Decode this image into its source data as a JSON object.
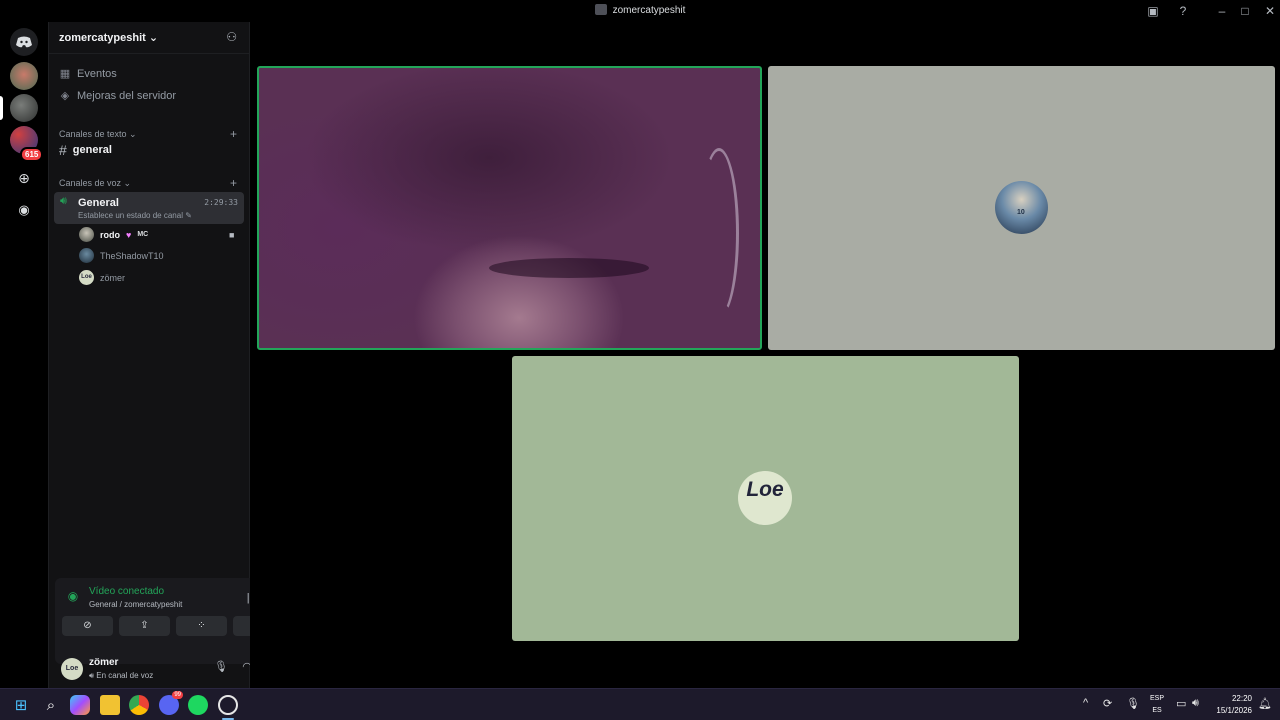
{
  "window": {
    "title": "zomercatypeshit"
  },
  "server": {
    "name": "zomercatypeshit",
    "name_suffix": "⌄"
  },
  "nav": [
    {
      "label": "Eventos"
    },
    {
      "label": "Mejoras del servidor"
    }
  ],
  "categories": {
    "text": "Canales de texto",
    "voice": "Canales de voz"
  },
  "text_channel": {
    "name": "general"
  },
  "voice_channel": {
    "name": "General",
    "status": "Establece un estado de canal",
    "duration": "2:29:33",
    "members": [
      {
        "name": "rodo",
        "tag": "MC",
        "streaming": true
      },
      {
        "name": "TheShadowT10"
      },
      {
        "name": "zömer"
      }
    ]
  },
  "guild_badge": "615",
  "rtc": {
    "state": "Vídeo conectado",
    "location": "General / zomercatypeshit"
  },
  "user": {
    "name": "zömer",
    "status": "En canal de voz",
    "avatar_text": "Loe"
  },
  "tiles": {
    "green_avatar_text": "Loe",
    "gray_avatar_jersey": "10"
  },
  "taskbar": {
    "lang_top": "ESP",
    "lang_bottom": "ES",
    "time": "22:20",
    "date": "15/1/2026",
    "discord_badge": "99"
  },
  "colors": {
    "accent": "#23a559",
    "badge": "#f23f43",
    "sidebar": "#121214",
    "tile_gray": "#a9aca4",
    "tile_green": "#a2b897"
  }
}
